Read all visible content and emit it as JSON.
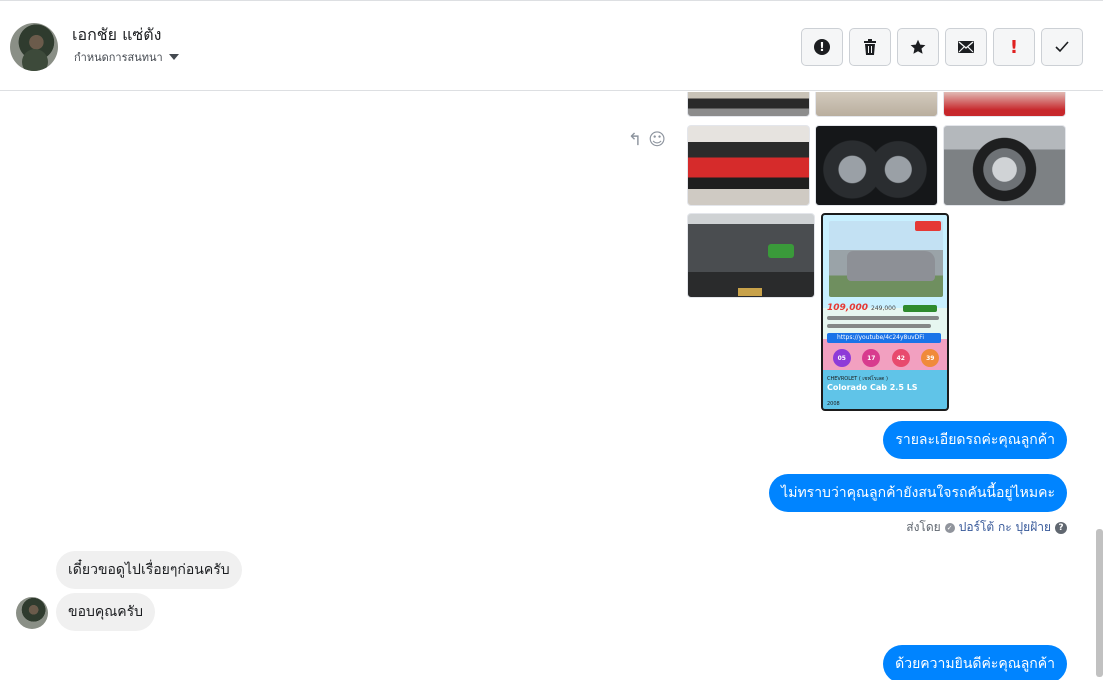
{
  "header": {
    "contact_name": "เอกชัย แซ่ตัง",
    "assign_label": "กำหนดการสนทนา",
    "toolbar": {
      "spam_icon": "alert-circle-icon",
      "delete_icon": "trash-icon",
      "star_icon": "star-icon",
      "unread_icon": "envelope-icon",
      "important_label": "!",
      "done_icon": "check-icon"
    }
  },
  "thread": {
    "message_actions": {
      "reply_icon": "reply-icon",
      "react_icon": "smiley-icon"
    },
    "poster": {
      "price": "109,000",
      "old_price": "249,000",
      "url_text": "https://youtube/4c24y8uvDFi",
      "badges": [
        "05",
        "17",
        "42",
        "39"
      ],
      "spec_text": "CHEVROLET ( เชฟโรเลต )",
      "model": "Colorado Cab 2.5 LS",
      "footer_text": "2008"
    },
    "outgoing": [
      {
        "text": "รายละเอียดรถค่ะคุณลูกค้า"
      },
      {
        "text": "ไม่ทราบว่าคุณลูกค้ายังสนใจรถคันนี้อยู่ไหมคะ"
      },
      {
        "text": "ด้วยความยินดีค่ะคุณลูกค้า"
      }
    ],
    "sent_by": {
      "prefix": "ส่งโดย",
      "agent": "ปอร์โต้ กะ ปุยฝ้าย",
      "help": "?"
    },
    "incoming": [
      {
        "text": "เดี๋ยวขอดูไปเรื่อยๆก่อนครับ"
      },
      {
        "text": "ขอบคุณครับ"
      }
    ]
  },
  "colors": {
    "outgoing_bubble": "#0084ff",
    "incoming_bubble": "#f0f0f0",
    "important": "#e02020"
  }
}
